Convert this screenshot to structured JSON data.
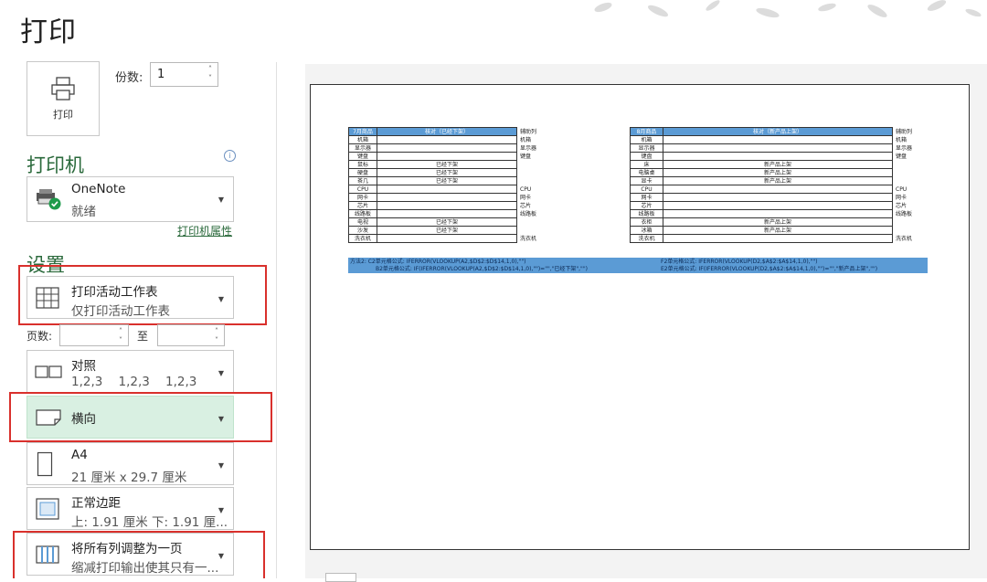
{
  "title": "打印",
  "print_button_label": "打印",
  "copies": {
    "label": "份数:",
    "value": "1"
  },
  "printer": {
    "heading": "打印机",
    "name": "OneNote",
    "status": "就绪",
    "properties_link": "打印机属性"
  },
  "settings": {
    "heading": "设置",
    "scope": {
      "title": "打印活动工作表",
      "subtitle": "仅打印活动工作表"
    },
    "pages": {
      "label": "页数:",
      "from_value": "",
      "to_label": "至",
      "to_value": ""
    },
    "collate": {
      "title": "对照",
      "subtitle": "1,2,3    1,2,3    1,2,3"
    },
    "orientation": {
      "title": "横向"
    },
    "paper": {
      "title": "A4",
      "subtitle": "21 厘米 x 29.7 厘米"
    },
    "margins": {
      "title": "正常边距",
      "subtitle": "上: 1.91 厘米 下: 1.91 厘..."
    },
    "scaling": {
      "title": "将所有列调整为一页",
      "subtitle": "缩减打印输出使其只有一..."
    }
  },
  "accent_color": "#2b6a3c",
  "highlight_color": "#d9302c",
  "preview": {
    "left_table": {
      "header": [
        "7月商品",
        "核对（已经下架）"
      ],
      "aux_header": "辅助列",
      "rows": [
        [
          "机箱",
          "",
          "机箱"
        ],
        [
          "显示器",
          "",
          "显示器"
        ],
        [
          "键盘",
          "",
          "键盘"
        ],
        [
          "鼠标",
          "已经下架",
          ""
        ],
        [
          "硬盘",
          "已经下架",
          ""
        ],
        [
          "茶几",
          "已经下架",
          ""
        ],
        [
          "CPU",
          "",
          "CPU"
        ],
        [
          "网卡",
          "",
          "网卡"
        ],
        [
          "芯片",
          "",
          "芯片"
        ],
        [
          "线路板",
          "",
          "线路板"
        ],
        [
          "电视",
          "已经下架",
          ""
        ],
        [
          "沙发",
          "已经下架",
          ""
        ],
        [
          "洗衣机",
          "",
          "洗衣机"
        ]
      ],
      "formula_1": "方法2:   C2单元格公式:  IFERROR(VLOOKUP(A2,$D$2:$D$14,1,0),\"\")",
      "formula_2": "B2单元格公式:  IF(IFERROR(VLOOKUP(A2,$D$2:$D$14,1,0),\"\")=\"\",\"已经下架\",\"\")"
    },
    "right_table": {
      "header": [
        "8月商品",
        "核对（新产品上架）"
      ],
      "aux_header": "辅助列",
      "rows": [
        [
          "机箱",
          "",
          "机箱"
        ],
        [
          "显示器",
          "",
          "显示器"
        ],
        [
          "键盘",
          "",
          "键盘"
        ],
        [
          "床",
          "新产品上架",
          ""
        ],
        [
          "电脑桌",
          "新产品上架",
          ""
        ],
        [
          "显卡",
          "新产品上架",
          ""
        ],
        [
          "CPU",
          "",
          "CPU"
        ],
        [
          "网卡",
          "",
          "网卡"
        ],
        [
          "芯片",
          "",
          "芯片"
        ],
        [
          "线路板",
          "",
          "线路板"
        ],
        [
          "衣柜",
          "新产品上架",
          ""
        ],
        [
          "冰箱",
          "新产品上架",
          ""
        ],
        [
          "洗衣机",
          "",
          "洗衣机"
        ]
      ],
      "formula_1": "F2单元格公式:  IFERROR(VLOOKUP(D2,$A$2:$A$14,1,0),\"\")",
      "formula_2": "E2单元格公式:  IF(IFERROR(VLOOKUP(D2,$A$2:$A$14,1,0),\"\")=\"\",\"新产品上架\",\"\")"
    }
  }
}
